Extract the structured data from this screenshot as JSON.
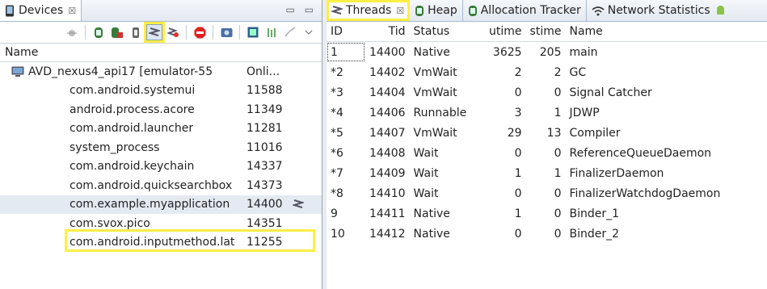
{
  "devices_panel": {
    "tab_label": "Devices",
    "close_glyph": "☒",
    "window_controls": "▭ ▭",
    "column_header": "Name",
    "device": {
      "name": "AVD_nexus4_api17 [emulator-55",
      "status": "Onli..."
    },
    "processes": [
      {
        "name": "com.android.systemui",
        "pid": "11588"
      },
      {
        "name": "android.process.acore",
        "pid": "11349"
      },
      {
        "name": "com.android.launcher",
        "pid": "11281"
      },
      {
        "name": "system_process",
        "pid": "11016"
      },
      {
        "name": "com.android.keychain",
        "pid": "14337"
      },
      {
        "name": "com.android.quicksearchbox",
        "pid": "14373"
      },
      {
        "name": "com.example.myapplication",
        "pid": "14400"
      },
      {
        "name": "com.svox.pico",
        "pid": "14351"
      },
      {
        "name": "com.android.inputmethod.lat",
        "pid": "11255"
      }
    ]
  },
  "toolbar_icons": [
    "debug-bug-icon",
    "update-heap-icon",
    "dump-hprof-icon",
    "gc-icon",
    "update-threads-icon",
    "start-method-profiling-icon",
    "stop-process-icon",
    "screen-capture-icon",
    "dump-view-hierarchy-icon",
    "systrace-icon",
    "view-menu-icon"
  ],
  "threads_panel": {
    "tabs": [
      {
        "label": "Threads",
        "icon": "threads-icon",
        "active": true
      },
      {
        "label": "Heap",
        "icon": "heap-icon",
        "active": false
      },
      {
        "label": "Allocation Tracker",
        "icon": "allocation-icon",
        "active": false
      },
      {
        "label": "Network Statistics",
        "icon": "network-icon",
        "active": false
      }
    ],
    "close_glyph": "☒",
    "columns": [
      "ID",
      "Tid",
      "Status",
      "utime",
      "stime",
      "Name"
    ],
    "rows": [
      [
        "1",
        "14400",
        "Native",
        "3625",
        "205",
        "main"
      ],
      [
        "*2",
        "14402",
        "VmWait",
        "2",
        "2",
        "GC"
      ],
      [
        "*3",
        "14404",
        "VmWait",
        "0",
        "0",
        "Signal Catcher"
      ],
      [
        "*4",
        "14406",
        "Runnable",
        "3",
        "1",
        "JDWP"
      ],
      [
        "*5",
        "14407",
        "VmWait",
        "29",
        "13",
        "Compiler"
      ],
      [
        "*6",
        "14408",
        "Wait",
        "0",
        "0",
        "ReferenceQueueDaemon"
      ],
      [
        "*7",
        "14409",
        "Wait",
        "1",
        "1",
        "FinalizerDaemon"
      ],
      [
        "*8",
        "14410",
        "Wait",
        "0",
        "0",
        "FinalizerWatchdogDaemon"
      ],
      [
        "9",
        "14411",
        "Native",
        "1",
        "0",
        "Binder_1"
      ],
      [
        "10",
        "14412",
        "Native",
        "0",
        "0",
        "Binder_2"
      ]
    ]
  }
}
